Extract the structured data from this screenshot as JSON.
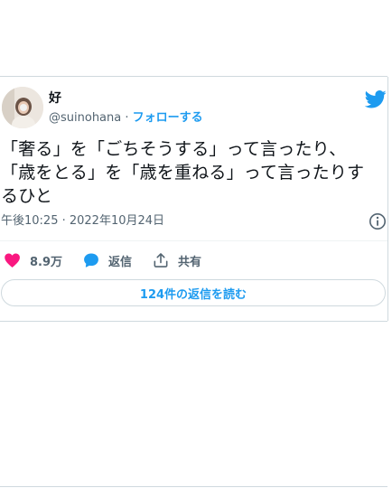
{
  "author": {
    "display_name": "好",
    "handle": "@suinohana",
    "separator": "·",
    "follow_label": "フォローする"
  },
  "tweet": {
    "lines": [
      "「奢る」を「ごちそうする」って言ったり、",
      "「歳をとる」を「歳を重ねる」って言ったりす",
      "るひと"
    ],
    "timestamp": "午後10:25 · 2022年10月24日"
  },
  "actions": {
    "like_count": "8.9万",
    "reply_label": "返信",
    "share_label": "共有"
  },
  "read_replies_label": "124件の返信を読む",
  "colors": {
    "accent": "#1d9bf0",
    "like": "#f91880",
    "muted": "#536471",
    "border": "#cfd9de"
  },
  "icons": [
    "avatar",
    "twitter-bird-icon",
    "info-icon",
    "heart-icon",
    "reply-bubble-icon",
    "share-icon"
  ]
}
